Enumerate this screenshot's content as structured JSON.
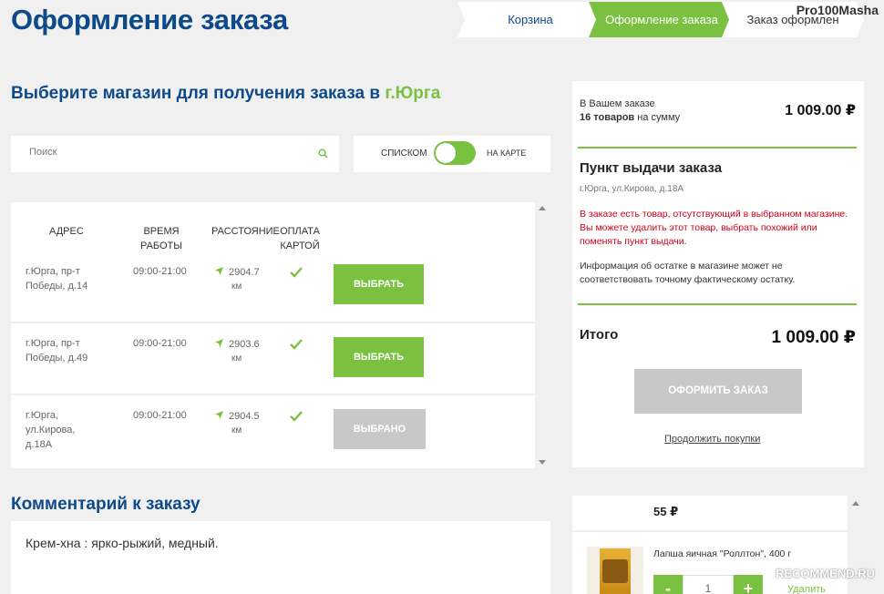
{
  "page": {
    "title": "Оформление заказа"
  },
  "steps": [
    "Корзина",
    "Оформление заказа",
    "Заказ оформлен"
  ],
  "watermark": {
    "top": "Pro100Masha",
    "bottom": "RECOMMEND.RU"
  },
  "store_select": {
    "heading": "Выберите магазин для получения заказа в ",
    "city": "г.Юрга",
    "search_placeholder": "Поиск",
    "view_list": "СПИСКОМ",
    "view_map": "НА КАРТЕ"
  },
  "table": {
    "headers": {
      "address": "АДРЕС",
      "hours_line1": "ВРЕМЯ",
      "hours_line2": "РАБОТЫ",
      "distance": "РАССТОЯНИЕ",
      "card_line1": "ОПЛАТА",
      "card_line2": "КАРТОЙ"
    },
    "rows": [
      {
        "address_line1": "г.Юрга, пр-т",
        "address_line2": "Победы, д.14",
        "address_line3": "",
        "hours": "09:00-21:00",
        "distance": "2904.7",
        "unit": "км",
        "button": "ВЫБРАТЬ"
      },
      {
        "address_line1": "г.Юрга, пр-т",
        "address_line2": "Победы, д.49",
        "address_line3": "",
        "hours": "09:00-21:00",
        "distance": "2903.6",
        "unit": "км",
        "button": "ВЫБРАТЬ"
      },
      {
        "address_line1": "г.Юрга,",
        "address_line2": "ул.Кирова,",
        "address_line3": "д.18А",
        "hours": "09:00-21:00",
        "distance": "2904.5",
        "unit": "км",
        "button": "ВЫБРАНО"
      }
    ]
  },
  "comment": {
    "heading": "Комментарий к заказу",
    "value": "Крем-хна : ярко-рыжий, медный."
  },
  "summary": {
    "line1": "В Вашем заказе",
    "items_bold": "16 товаров",
    "items_rest": " на сумму",
    "total_top": "1 009.00 ₽",
    "pickup_title": "Пункт выдачи заказа",
    "pickup_address": "г.Юрга, ул.Кирова, д.18А",
    "warning": "В заказе есть товар, отсутствующий в выбранном магазине. Вы можете удалить этот товар, выбрать похожий или поменять пункт выдачи.",
    "info": "Информация об остатке в магазине может не соответствовать точному фактическому остатку.",
    "total_label": "Итого",
    "total_value": "1 009.00 ₽",
    "order_button": "ОФОРМИТЬ ЗАКАЗ",
    "continue_link": "Продолжить покупки"
  },
  "cart": {
    "price": "55 ₽",
    "product_name": "Лапша яичная \"Роллтон\", 400 г",
    "qty_minus": "-",
    "qty_plus": "+",
    "qty_value": "1",
    "delete": "Удалить"
  },
  "colors": {
    "brand_blue": "#0e4a8a",
    "accent_green": "#7ac142",
    "warning_red": "#d0021b",
    "disabled_gray": "#c8c8c8"
  }
}
